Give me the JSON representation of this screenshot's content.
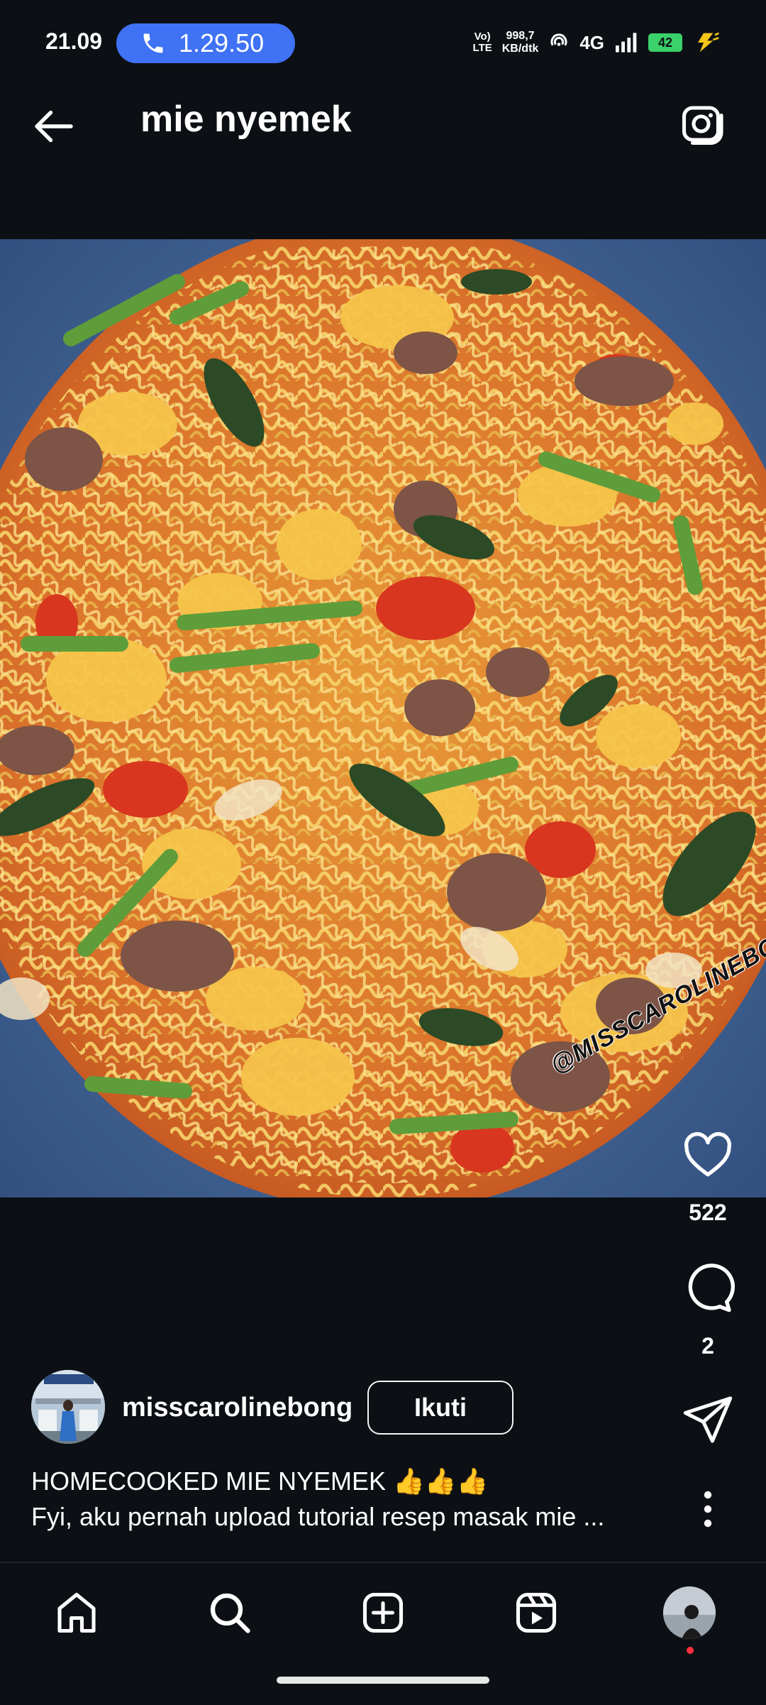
{
  "status_bar": {
    "time": "21.09",
    "call_timer": "1.29.50",
    "volte": "Vo)\nLTE",
    "speed": "998,7\nKB/dtk",
    "network": "4G",
    "battery": "42"
  },
  "header": {
    "title": "mie nyemek"
  },
  "post": {
    "watermark": "@MISSCAROLINEBONG",
    "likes": "522",
    "comments": "2",
    "author": "misscarolinebong",
    "follow_label": "Ikuti",
    "caption_title": "HOMECOOKED MIE NYEMEK 👍👍👍",
    "caption_body": "Fyi, aku pernah upload tutorial resep masak mie ..."
  },
  "icons": {
    "back": "arrow-left-icon",
    "camera": "camera-icon",
    "like": "heart-icon",
    "comment": "comment-icon",
    "share": "send-icon",
    "more": "more-vertical-icon",
    "home": "home-icon",
    "search": "search-icon",
    "create": "plus-square-icon",
    "reels": "reels-icon",
    "profile": "profile-avatar"
  },
  "colors": {
    "background": "#0c1014",
    "call_pill": "#3f72f4",
    "battery": "#3ad06a",
    "notification_dot": "#ff3040"
  }
}
